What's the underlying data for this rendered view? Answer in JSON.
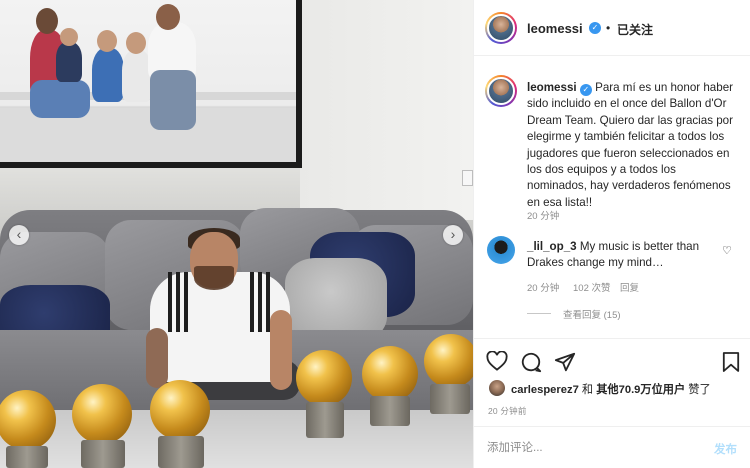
{
  "post": {
    "carousel": {
      "prev_icon": "chevron-left-icon",
      "next_icon": "chevron-right-icon",
      "prev_glyph": "‹",
      "next_glyph": "›"
    }
  },
  "header": {
    "username": "leomessi",
    "verified_glyph": "✓",
    "separator": "•",
    "follow_label": "已关注"
  },
  "caption": {
    "username": "leomessi",
    "text": "Para mí es un honor haber sido incluido en el once del Ballon d'Or Dream Team. Quiero dar las gracias por elegirme y también felicitar a todos los jugadores que fueron seleccionados en los dos equipos y a todos los nominados, hay verdaderos fenómenos en esa lista!!",
    "time": "20 分钟"
  },
  "comments": [
    {
      "username": "_lil_op_3",
      "text": "My music is better than Drakes change my mind…",
      "time": "20 分钟",
      "likes": "102 次赞",
      "reply_label": "回复",
      "heart_glyph": "♡",
      "view_replies": "查看回复 (15)"
    }
  ],
  "actions": {
    "like_icon": "heart-icon",
    "comment_icon": "comment-icon",
    "share_icon": "paper-plane-icon",
    "save_icon": "bookmark-icon"
  },
  "likes": {
    "liker": "carlesperez7",
    "connector": "和",
    "others_prefix": "其他",
    "count": "70.9万",
    "suffix": "位用户",
    "verb": "赞了"
  },
  "posted_time": "20 分钟前",
  "add_comment": {
    "placeholder": "添加评论...",
    "post_label": "发布"
  }
}
